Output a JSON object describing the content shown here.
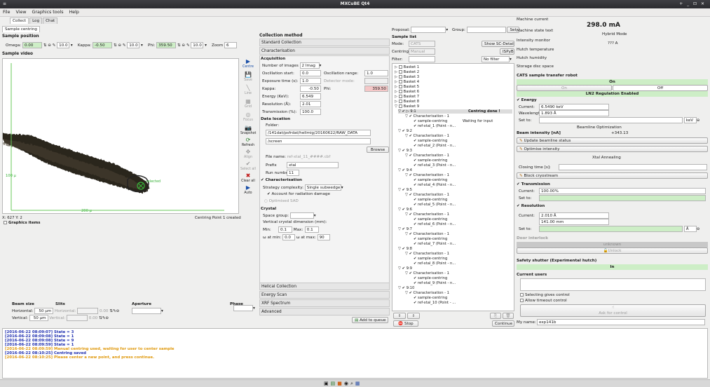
{
  "window": {
    "title": "MXCuBE Qt4",
    "controls": "+ _ ⊡ ✕"
  },
  "menu": [
    "File",
    "View",
    "Graphics tools",
    "Help"
  ],
  "tabs": [
    "Collect",
    "Log",
    "Chat"
  ],
  "subtab": "Sample centring",
  "sample_position": {
    "title": "Sample position",
    "omega_label": "Omega:",
    "omega_value": "0.00",
    "omega_step": "10.0",
    "kappa_label": "Kappa:",
    "kappa_value": "-0.50",
    "kappa_step": "10.0",
    "phi_label": "Phi:",
    "phi_value": "359.50",
    "phi_step": "10.0",
    "zoom_label": "Zoom",
    "zoom_value": "6"
  },
  "sample_video": {
    "title": "Sample video",
    "scale_v": "100 µ",
    "scale_h": "200 µ",
    "point_label": "selected",
    "coords": "X: 627 Y: 2",
    "graphics_items": "Graphics items",
    "status": "Centring Point 1 created"
  },
  "tools": [
    {
      "name": "Centre",
      "icon": "▶",
      "enabled": true
    },
    {
      "name": "Save",
      "icon": "💾",
      "enabled": false
    },
    {
      "name": "Line",
      "icon": "╲",
      "enabled": false
    },
    {
      "name": "Grid",
      "icon": "▦",
      "enabled": false
    },
    {
      "name": "Focus",
      "icon": "◎",
      "enabled": false
    },
    {
      "name": "Snapshot",
      "icon": "📷",
      "enabled": true
    },
    {
      "name": "Refresh",
      "icon": "⟳",
      "enabled": true
    },
    {
      "name": "Align",
      "icon": "✥",
      "enabled": false
    },
    {
      "name": "Select all",
      "icon": "✔",
      "enabled": false
    },
    {
      "name": "Clear all",
      "icon": "✖",
      "enabled": true
    },
    {
      "name": "Auto",
      "icon": "▶",
      "enabled": true
    }
  ],
  "beam": {
    "beam_size": "Beam size",
    "slits": "Slits",
    "aperture": "Aperture",
    "phase": "Phase",
    "horizontal_label": "Horizontal:",
    "horizontal_value": "50 µm",
    "vertical_label": "Vertical:",
    "vertical_value": "50 µm",
    "slit_h_label": "Horizontal:",
    "slit_v_label": "Vertical:",
    "slit_h_value": "0.00",
    "slit_v_value": "0.00"
  },
  "collection": {
    "title": "Collection method",
    "standard": "Standard Collection",
    "characterisation": "Characterisation",
    "acquisition": "Acquisition",
    "num_images_label": "Number of images",
    "num_images_value": "2 Imag",
    "osc_start_label": "Oscillation start:",
    "osc_start_value": "0.0",
    "osc_range_label": "Oscillation range:",
    "osc_range_value": "1.0",
    "exposure_label": "Exposure time (s):",
    "exposure_value": "1.0",
    "detector_mode_label": "Detector mode:",
    "kappa_label": "Kappa:",
    "kappa_value": "-0.50",
    "phi_label": "Phi:",
    "phi_value": "359.50",
    "energy_label": "Energy (KeV):",
    "energy_value": "6.549",
    "resolution_label": "Resolution (Å):",
    "resolution_value": "2.01",
    "transmission_label": "Transmission (%):",
    "transmission_value": "100.0",
    "data_location": "Data location",
    "folder_label": "Folder:",
    "folder_value": "/141dat/psfrdat/hellmig/20160622/RAW_DATA",
    "sub_value": "/screen",
    "browse": "Browse",
    "file_name_label": "File name:",
    "file_name_value": "ref-xtal_11_####.cbf",
    "prefix_label": "Prefix",
    "prefix_value": "xtal",
    "run_label": "Run number",
    "run_value": "11",
    "char_title": "Characterisation",
    "strategy_label": "Strategy complexity:",
    "strategy_value": "Single subwedge",
    "radiation": "Account for radiation damage",
    "opt_sad": "Optimised SAD",
    "crystal": "Crystal",
    "space_group_label": "Space group:",
    "vcd_label": "Vertical crystal dimension (mm):",
    "min_label": "Min:",
    "min_value": "0.1",
    "max_label": "Max:",
    "max_value": "0.1",
    "wmin_label": "ω at min:",
    "wmin_value": "0.0",
    "wmax_label": "ω at max:",
    "wmax_value": "90",
    "helical": "Helical Collection",
    "energy_scan": "Energy Scan",
    "xrf": "XRF Spectrum",
    "advanced": "Advanced",
    "add_queue": "Add to queue"
  },
  "sample_list": {
    "proposal_label": "Proposal:",
    "group_label": "Group:",
    "set": "Set",
    "title": "Sample list",
    "mode_label": "Mode:",
    "mode_value": "CATS",
    "show_sc": "Show SC-Details",
    "centring_label": "Centring:",
    "centring_value": "Manual",
    "ispyb": "ISPyB",
    "filter_label": "Filter:",
    "filter_value": "No filter",
    "baskets": [
      "Basket 1",
      "Basket 2",
      "Basket 3",
      "Basket 4",
      "Basket 5",
      "Basket 6",
      "Basket 7",
      "Basket 8",
      "Basket 9"
    ],
    "node_first": "9:1",
    "centring_done": "Centring done !",
    "waiting": "Waiting for input",
    "char": "Characterisation - 1",
    "sc": "sample-centring",
    "nodes": [
      {
        "id": "9:1",
        "ref": "ref-xtal_1 (Point - n..."
      },
      {
        "id": "9:2",
        "ref": "ref-xtal_2 (Point - n..."
      },
      {
        "id": "9:3",
        "ref": "ref-xtal_3 (Point - n..."
      },
      {
        "id": "9:4",
        "ref": "ref-xtal_4 (Point - n..."
      },
      {
        "id": "9:5",
        "ref": "ref-xtal_5 (Point - n..."
      },
      {
        "id": "9:6",
        "ref": "ref-xtal_6 (Point - n..."
      },
      {
        "id": "9:7",
        "ref": "ref-xtal_7 (Point - n..."
      },
      {
        "id": "9:8",
        "ref": "ref-xtal_8 (Point - n..."
      },
      {
        "id": "9:9",
        "ref": "ref-xtal_9 (Point - n..."
      },
      {
        "id": "9:10",
        "ref": "ref-xtal_10 (Point - ..."
      }
    ],
    "stop": "Stop",
    "continue": "Continue"
  },
  "status_panel": {
    "machine_current": "Machine current",
    "machine_current_value": "298.0 mA",
    "state_text": "Machine state text",
    "state_text_value": "Hybrid Mode",
    "intensity": "Intensity monitor",
    "intensity_value": "??? A",
    "hutch_temp": "Hutch temperature",
    "hutch_hum": "Hutch humidity",
    "storage": "Storage disc space",
    "cats": "CATS sample transfer robot",
    "on": "On",
    "on_btn": "On",
    "off_btn": "Off",
    "ln2": "LN2 Regulation Enabled",
    "energy": "Energy",
    "current_label": "Current:",
    "energy_value": "6.5490 keV",
    "wavelength_label": "Wavelength:",
    "wavelength_value": "1.893 Å",
    "set_to_label": "Set to:",
    "energy_unit": "keV",
    "beamline_opt": "Beamline Optimization",
    "beam_intensity_label": "Beam intensity [nA]",
    "beam_intensity_value": "+343.13",
    "update_status": "Update beamline status",
    "optimise": "Optimise intensity",
    "xtal_annealing": "Xtal Annealing",
    "closing_label": "Closing time [s]:",
    "block_cryo": "Block cryostream",
    "transmission": "Transmission",
    "trans_value": "100.00%",
    "resolution": "Resolution",
    "res_value": "2.010 Å",
    "res_mm": "141.00 mm",
    "res_unit": "Å",
    "door": "Door interlock",
    "unknown": "unknown",
    "unlock": "Unlock",
    "shutter": "Safety shutter (Experimental hutch)",
    "shutter_state": "In",
    "current_users": "Current users",
    "selecting": "Selecting gives control",
    "allow": "Allow timeout control",
    "ask": "Ask for control",
    "myname_label": "My name:",
    "myname_value": "exp141b"
  },
  "log": [
    {
      "text": "[2016-06-22 08:09:07] State = 3",
      "color": "#1f2fb0",
      "bold": true
    },
    {
      "text": "[2016-06-22 08:09:08] State = 1",
      "color": "#1f2fb0",
      "bold": true
    },
    {
      "text": "[2016-06-22 08:09:08] State = 9",
      "color": "#1f2fb0",
      "bold": true
    },
    {
      "text": "[2016-06-22 08:09:59] State = 1",
      "color": "#1f2fb0",
      "bold": true
    },
    {
      "text": "[2016-06-22 08:09:59] Manual centring used, waiting for user to center sample",
      "color": "#e09a10",
      "bold": true
    },
    {
      "text": "[2016-06-22 08:10:25] Centring saved",
      "color": "#1f2fb0",
      "bold": true
    },
    {
      "text": "[2016-06-22 08:10:25] Please center a new point, and press continue.",
      "color": "#e09a10",
      "bold": true
    }
  ]
}
